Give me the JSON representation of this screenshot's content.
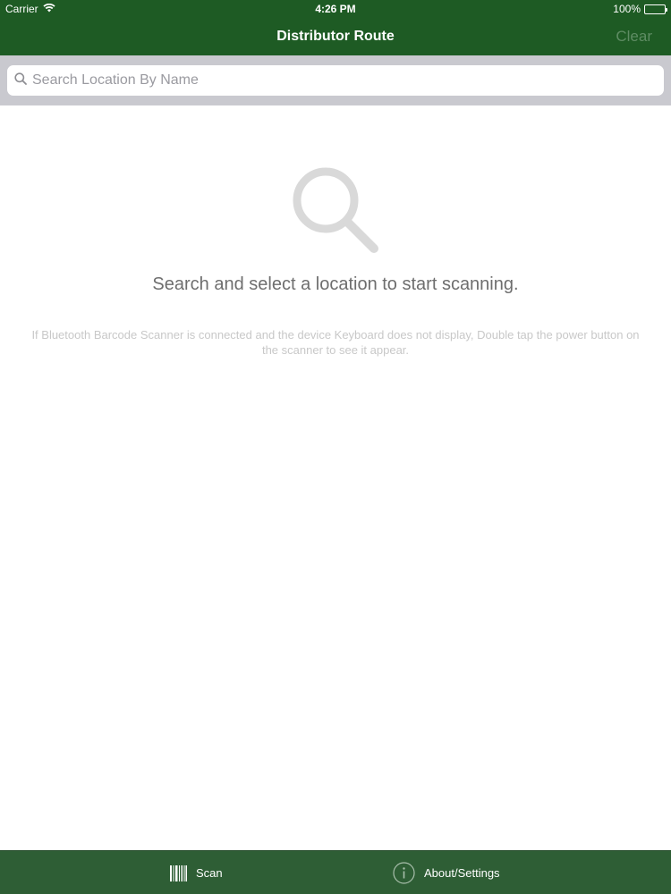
{
  "status_bar": {
    "carrier": "Carrier",
    "time": "4:26 PM",
    "battery": "100%",
    "battery_level": 1.0
  },
  "nav": {
    "title": "Distributor Route",
    "clear_label": "Clear"
  },
  "search": {
    "placeholder": "Search Location By Name",
    "value": ""
  },
  "empty_state": {
    "icon": "magnifier-icon",
    "message": "Search and select a location to start scanning.",
    "hint": "If Bluetooth Barcode Scanner is connected and the device Keyboard does not display, Double tap the power button on the scanner to see it appear."
  },
  "tabs": [
    {
      "label": "Scan",
      "icon": "barcode-icon"
    },
    {
      "label": "About/Settings",
      "icon": "info-icon"
    }
  ],
  "colors": {
    "header": "#1e5b24",
    "tab_bar": "#2e5e35",
    "search_area": "#c9c9cf",
    "clear_disabled": "#5e8c63"
  }
}
